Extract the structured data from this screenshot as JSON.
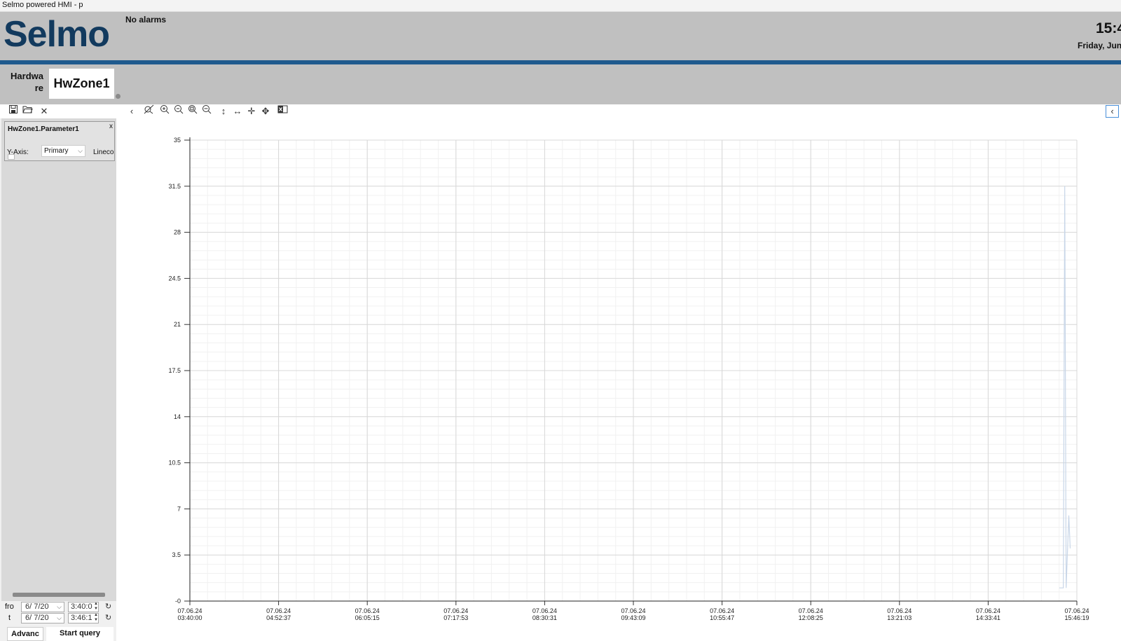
{
  "window": {
    "title": "Selmo powered HMI - p"
  },
  "header": {
    "logo_text": "Selmo",
    "alarm_status": "No alarms",
    "clock": "15:4",
    "date": "Friday, Jun"
  },
  "tabs": {
    "section_label": "Hardware",
    "active_tab": "HwZone1"
  },
  "toolbar": {
    "icons": [
      "save-icon",
      "open-folder-icon",
      "close-icon",
      "collapse-left-icon",
      "reset-zoom-icon",
      "zoom-in-icon",
      "zoom-out-icon",
      "zoom-fit-icon",
      "zoom-out-alt-icon",
      "vertical-pan-icon",
      "horizontal-pan-icon",
      "move-icon",
      "pan-all-icon",
      "export-excel-icon"
    ]
  },
  "sidebar": {
    "parameter": {
      "name": "HwZone1.Parameter1",
      "close_label": "x",
      "yaxis_label": "Y-Axis:",
      "yaxis_value": "Primary",
      "linecolor_label": "Linecolo"
    },
    "time_query": {
      "from_label": "fro",
      "to_label": "t",
      "from_date": "6/ 7/20",
      "from_time": "3:40:0",
      "to_date": "6/ 7/20",
      "to_time": "3:46:1",
      "advanced_label": "Advanc",
      "start_query_label": "Start query"
    }
  },
  "colors": {
    "brand_blue": "#1f5a8e",
    "logo": "#123a5e",
    "header_bg": "#c0c0c0",
    "series": "#c8d6e8"
  },
  "chart_data": {
    "type": "line",
    "title": "",
    "xlabel": "",
    "ylabel": "",
    "ylim": [
      0,
      35
    ],
    "yticks": [
      "35",
      "31.5",
      "28",
      "24.5",
      "21",
      "17.5",
      "14",
      "10.5",
      "7",
      "3.5",
      "-0"
    ],
    "x_ticks": [
      {
        "date": "07.06.24",
        "time": "03:40:00"
      },
      {
        "date": "07.06.24",
        "time": "04:52:37"
      },
      {
        "date": "07.06.24",
        "time": "06:05:15"
      },
      {
        "date": "07.06.24",
        "time": "07:17:53"
      },
      {
        "date": "07.06.24",
        "time": "08:30:31"
      },
      {
        "date": "07.06.24",
        "time": "09:43:09"
      },
      {
        "date": "07.06.24",
        "time": "10:55:47"
      },
      {
        "date": "07.06.24",
        "time": "12:08:25"
      },
      {
        "date": "07.06.24",
        "time": "13:21:03"
      },
      {
        "date": "07.06.24",
        "time": "14:33:41"
      },
      {
        "date": "07.06.24",
        "time": "15:46:19"
      }
    ],
    "grid": true,
    "series": [
      {
        "x": [
          "07.06.24 15:40",
          "07.06.24 15:40",
          "07.06.24 15:41",
          "07.06.24 15:41",
          "07.06.24 15:41",
          "07.06.24 15:42",
          "07.06.24 15:42"
        ],
        "values": [
          1.0,
          1.0,
          1.0,
          31.5,
          1.0,
          6.5,
          4.0
        ]
      }
    ]
  }
}
